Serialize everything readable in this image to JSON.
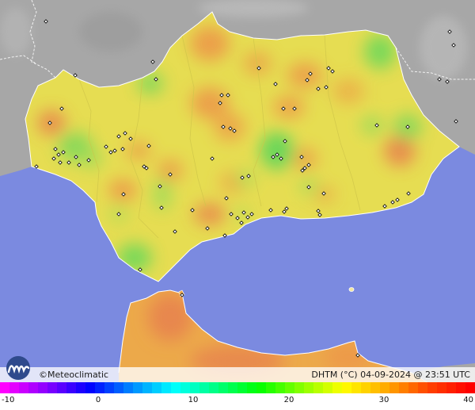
{
  "map": {
    "brand": "©Meteoclimatic",
    "caption": "DHTM (°C) 04-09-2024 @ 23:51 UTC",
    "colors": {
      "sea": "#7b8ae0",
      "land_outside": "#a6a6a6",
      "region_base": "#e6dd52",
      "africa_base": "#eca94a"
    }
  },
  "legend": {
    "ticks": [
      "-10",
      "0",
      "10",
      "20",
      "30",
      "40"
    ],
    "gradient": [
      "#ff00ff",
      "#8800ff",
      "#0000ff",
      "#0088ff",
      "#00ffff",
      "#00ff80",
      "#00ff00",
      "#88ff00",
      "#ffff00",
      "#ffaa00",
      "#ff4400",
      "#ff0000"
    ]
  }
}
